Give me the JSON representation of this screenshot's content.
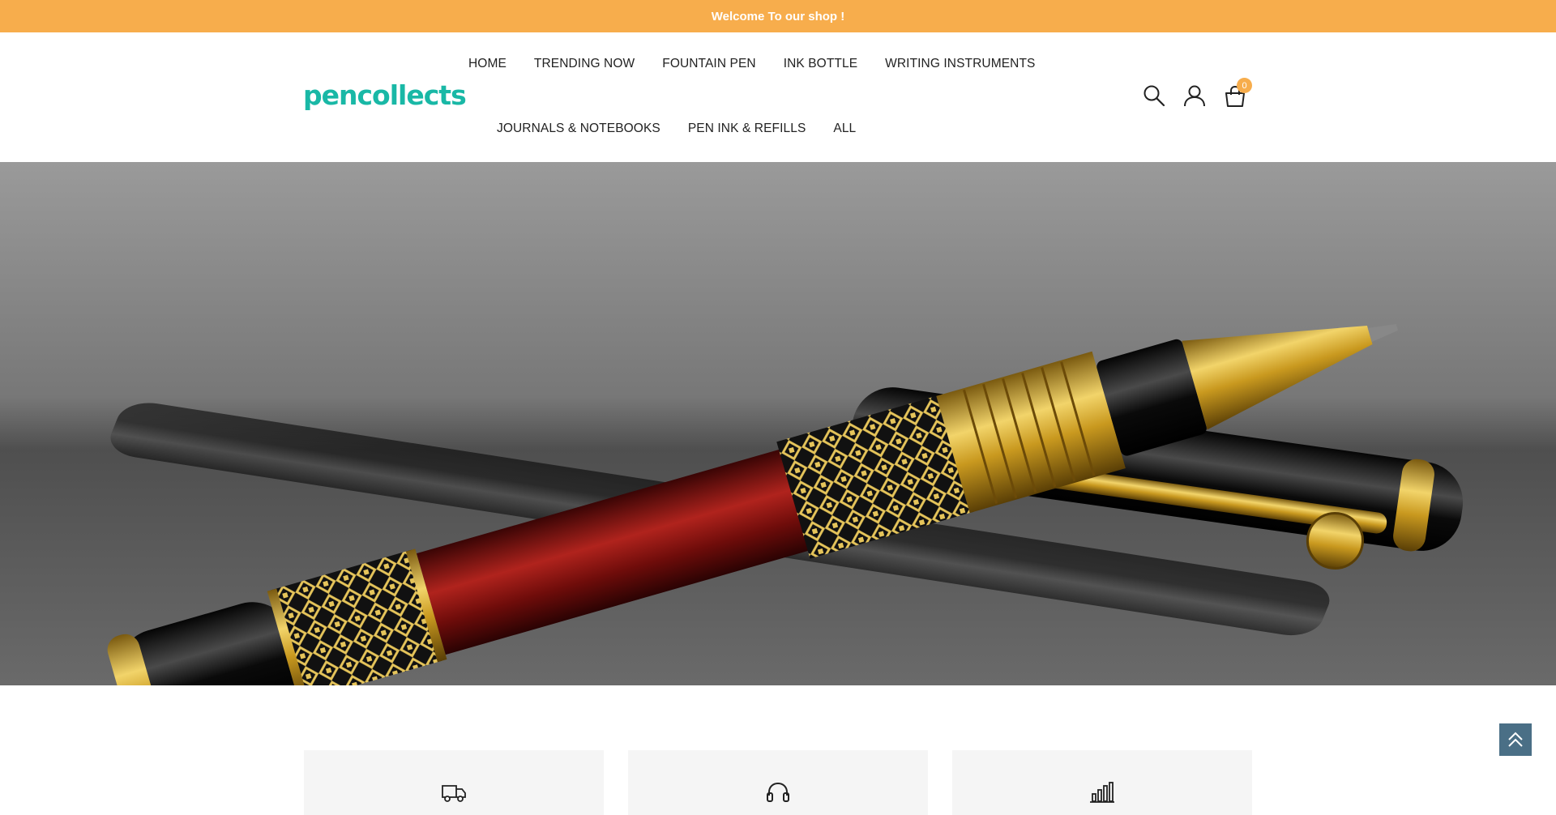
{
  "announcement": {
    "text": "Welcome To our shop !"
  },
  "brand": {
    "logo_text": "pencollects",
    "color": "#19b8a6"
  },
  "nav": {
    "row1": [
      "HOME",
      "TRENDING NOW",
      "FOUNTAIN PEN",
      "INK BOTTLE",
      "WRITING INSTRUMENTS"
    ],
    "row2": [
      "JOURNALS & NOTEBOOKS",
      "PEN INK & REFILLS",
      "ALL"
    ]
  },
  "header_icons": {
    "search": "search-icon",
    "account": "user-icon",
    "cart": "shopping-bag-icon",
    "cart_count": "0"
  },
  "hero": {
    "image": "gold and red fountain pen on reflective surface"
  },
  "features": [
    {
      "icon": "delivery-truck-icon"
    },
    {
      "icon": "headset-support-icon"
    },
    {
      "icon": "bar-chart-icon"
    }
  ],
  "colors": {
    "accent": "#f7ad4c",
    "scroll_top_bg": "#4a6f86"
  }
}
